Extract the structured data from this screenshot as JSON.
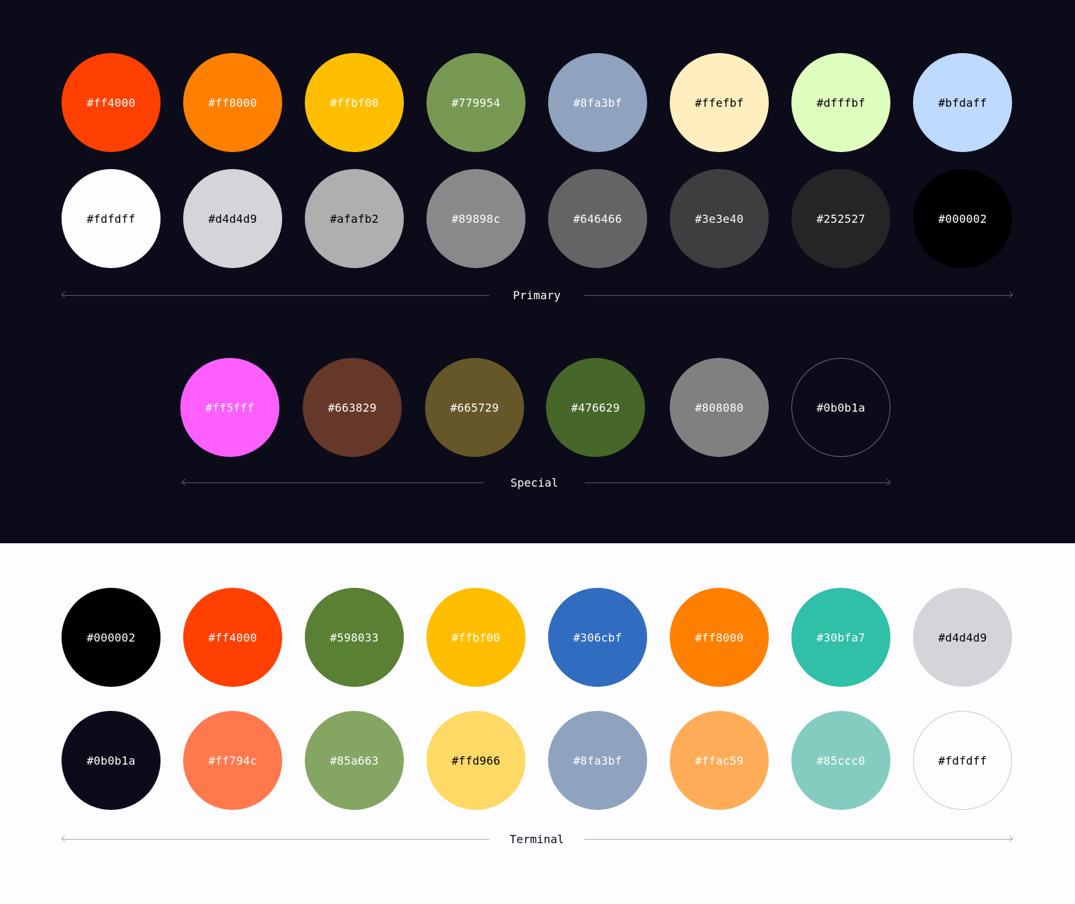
{
  "primary": {
    "label": "Primary",
    "row1": [
      {
        "hex": "#ff4000",
        "text_color": "#fdfdff"
      },
      {
        "hex": "#ff8000",
        "text_color": "#fdfdff"
      },
      {
        "hex": "#ffbf00",
        "text_color": "#fdfdff"
      },
      {
        "hex": "#779954",
        "text_color": "#fdfdff"
      },
      {
        "hex": "#8fa3bf",
        "text_color": "#fdfdff"
      },
      {
        "hex": "#ffefbf",
        "text_color": "#000002"
      },
      {
        "hex": "#dfffbf",
        "text_color": "#000002"
      },
      {
        "hex": "#bfdaff",
        "text_color": "#000002"
      }
    ],
    "row2": [
      {
        "hex": "#fdfdff",
        "text_color": "#000002"
      },
      {
        "hex": "#d4d4d9",
        "text_color": "#000002"
      },
      {
        "hex": "#afafb2",
        "text_color": "#000002"
      },
      {
        "hex": "#89898c",
        "text_color": "#fdfdff"
      },
      {
        "hex": "#646466",
        "text_color": "#fdfdff"
      },
      {
        "hex": "#3e3e40",
        "text_color": "#fdfdff"
      },
      {
        "hex": "#252527",
        "text_color": "#fdfdff"
      },
      {
        "hex": "#000002",
        "text_color": "#fdfdff"
      }
    ]
  },
  "special": {
    "label": "Special",
    "row": [
      {
        "hex": "#ff5fff",
        "text_color": "#fdfdff"
      },
      {
        "hex": "#663829",
        "text_color": "#fdfdff"
      },
      {
        "hex": "#665729",
        "text_color": "#fdfdff"
      },
      {
        "hex": "#476629",
        "text_color": "#fdfdff"
      },
      {
        "hex": "#808080",
        "text_color": "#fdfdff"
      },
      {
        "hex": "#0b0b1a",
        "text_color": "#fdfdff",
        "outlined": true
      }
    ]
  },
  "terminal": {
    "label": "Terminal",
    "row1": [
      {
        "hex": "#000002",
        "text_color": "#fdfdff"
      },
      {
        "hex": "#ff4000",
        "text_color": "#fdfdff"
      },
      {
        "hex": "#598033",
        "text_color": "#fdfdff"
      },
      {
        "hex": "#ffbf00",
        "text_color": "#fdfdff"
      },
      {
        "hex": "#306cbf",
        "text_color": "#fdfdff"
      },
      {
        "hex": "#ff8000",
        "text_color": "#fdfdff"
      },
      {
        "hex": "#30bfa7",
        "text_color": "#fdfdff"
      },
      {
        "hex": "#d4d4d9",
        "text_color": "#000002"
      }
    ],
    "row2": [
      {
        "hex": "#0b0b1a",
        "text_color": "#fdfdff"
      },
      {
        "hex": "#ff794c",
        "text_color": "#fdfdff"
      },
      {
        "hex": "#85a663",
        "text_color": "#fdfdff"
      },
      {
        "hex": "#ffd966",
        "text_color": "#000002"
      },
      {
        "hex": "#8fa3bf",
        "text_color": "#fdfdff"
      },
      {
        "hex": "#ffac59",
        "text_color": "#fdfdff"
      },
      {
        "hex": "#85ccc0",
        "text_color": "#fdfdff"
      },
      {
        "hex": "#fdfdff",
        "text_color": "#000002",
        "outlined": true
      }
    ]
  },
  "colors": {
    "dark_background": "#0b0b1a",
    "light_background": "#fdfdff"
  }
}
